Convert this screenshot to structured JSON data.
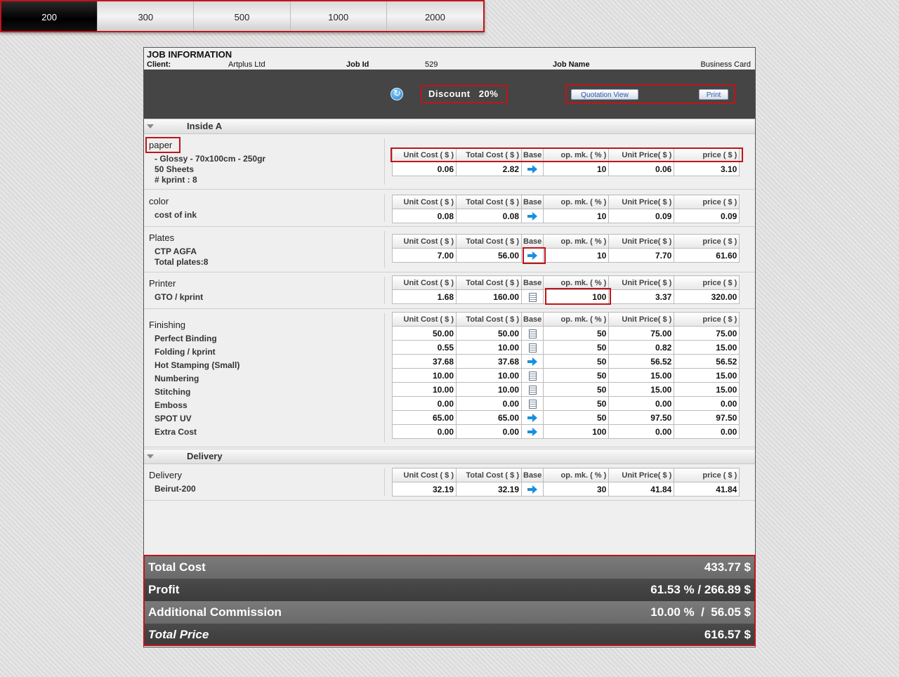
{
  "quantities": [
    {
      "label": "200",
      "active": true
    },
    {
      "label": "300",
      "active": false
    },
    {
      "label": "500",
      "active": false
    },
    {
      "label": "1000",
      "active": false
    },
    {
      "label": "2000",
      "active": false
    }
  ],
  "job": {
    "title": "JOB INFORMATION",
    "client_label": "Client:",
    "client": "Artplus Ltd",
    "job_id_label": "Job Id",
    "job_id": "529",
    "job_name_label": "Job Name",
    "job_name": "Business Card"
  },
  "toolbar": {
    "refresh_icon": "refresh-icon",
    "discount_label": "Discount",
    "discount_value": "20%",
    "quotation_label": "Quotation View",
    "print_label": "Print"
  },
  "columns": {
    "unit_cost": "Unit Cost ( $ )",
    "total_cost": "Total Cost ( $ )",
    "base": "Base",
    "op_mk": "op. mk. ( % )",
    "unit_price": "Unit Price( $ )",
    "price": "price ( $ )"
  },
  "sections": {
    "inside": "Inside A",
    "delivery": "Delivery"
  },
  "paper": {
    "title": "paper",
    "lines": [
      "- Glossy - 70x100cm - 250gr",
      "50 Sheets",
      "# kprint : 8"
    ],
    "row": {
      "unit_cost": "0.06",
      "total_cost": "2.82",
      "base": "arrow",
      "op_mk": "10",
      "unit_price": "0.06",
      "price": "3.10"
    }
  },
  "color": {
    "title": "color",
    "lines": [
      "cost of ink"
    ],
    "row": {
      "unit_cost": "0.08",
      "total_cost": "0.08",
      "base": "arrow",
      "op_mk": "10",
      "unit_price": "0.09",
      "price": "0.09"
    }
  },
  "plates": {
    "title": "Plates",
    "lines": [
      "CTP AGFA",
      "Total plates:8"
    ],
    "row": {
      "unit_cost": "7.00",
      "total_cost": "56.00",
      "base": "arrow",
      "op_mk": "10",
      "unit_price": "7.70",
      "price": "61.60"
    }
  },
  "printer": {
    "title": "Printer",
    "lines": [
      "GTO / kprint"
    ],
    "row": {
      "unit_cost": "1.68",
      "total_cost": "160.00",
      "base": "calc",
      "op_mk": "100",
      "unit_price": "3.37",
      "price": "320.00"
    }
  },
  "finishing": {
    "title": "Finishing",
    "items": [
      {
        "name": "Perfect Binding",
        "unit_cost": "50.00",
        "total_cost": "50.00",
        "base": "calc",
        "op_mk": "50",
        "unit_price": "75.00",
        "price": "75.00"
      },
      {
        "name": "Folding / kprint",
        "unit_cost": "0.55",
        "total_cost": "10.00",
        "base": "calc",
        "op_mk": "50",
        "unit_price": "0.82",
        "price": "15.00"
      },
      {
        "name": "Hot Stamping (Small)",
        "unit_cost": "37.68",
        "total_cost": "37.68",
        "base": "arrow",
        "op_mk": "50",
        "unit_price": "56.52",
        "price": "56.52"
      },
      {
        "name": "Numbering",
        "unit_cost": "10.00",
        "total_cost": "10.00",
        "base": "calc",
        "op_mk": "50",
        "unit_price": "15.00",
        "price": "15.00"
      },
      {
        "name": "Stitching",
        "unit_cost": "10.00",
        "total_cost": "10.00",
        "base": "calc",
        "op_mk": "50",
        "unit_price": "15.00",
        "price": "15.00"
      },
      {
        "name": "Emboss",
        "unit_cost": "0.00",
        "total_cost": "0.00",
        "base": "calc",
        "op_mk": "50",
        "unit_price": "0.00",
        "price": "0.00"
      },
      {
        "name": "SPOT UV",
        "unit_cost": "65.00",
        "total_cost": "65.00",
        "base": "arrow",
        "op_mk": "50",
        "unit_price": "97.50",
        "price": "97.50"
      },
      {
        "name": "Extra Cost",
        "unit_cost": "0.00",
        "total_cost": "0.00",
        "base": "arrow",
        "op_mk": "100",
        "unit_price": "0.00",
        "price": "0.00"
      }
    ]
  },
  "delivery": {
    "title": "Delivery",
    "lines": [
      "Beirut-200"
    ],
    "row": {
      "unit_cost": "32.19",
      "total_cost": "32.19",
      "base": "arrow",
      "op_mk": "30",
      "unit_price": "41.84",
      "price": "41.84"
    }
  },
  "totals": {
    "total_cost_label": "Total Cost",
    "total_cost": "433.77 $",
    "profit_label": "Profit",
    "profit": "61.53 % / 266.89 $",
    "commission_label": "Additional Commission",
    "commission": "10.00 %  /  56.05 $",
    "total_price_label": "Total Price",
    "total_price": "616.57 $"
  },
  "colors": {
    "highlight_border": "#c0141b",
    "toolbar_bg": "#454545",
    "arrow_blue": "#1a8ee0"
  }
}
